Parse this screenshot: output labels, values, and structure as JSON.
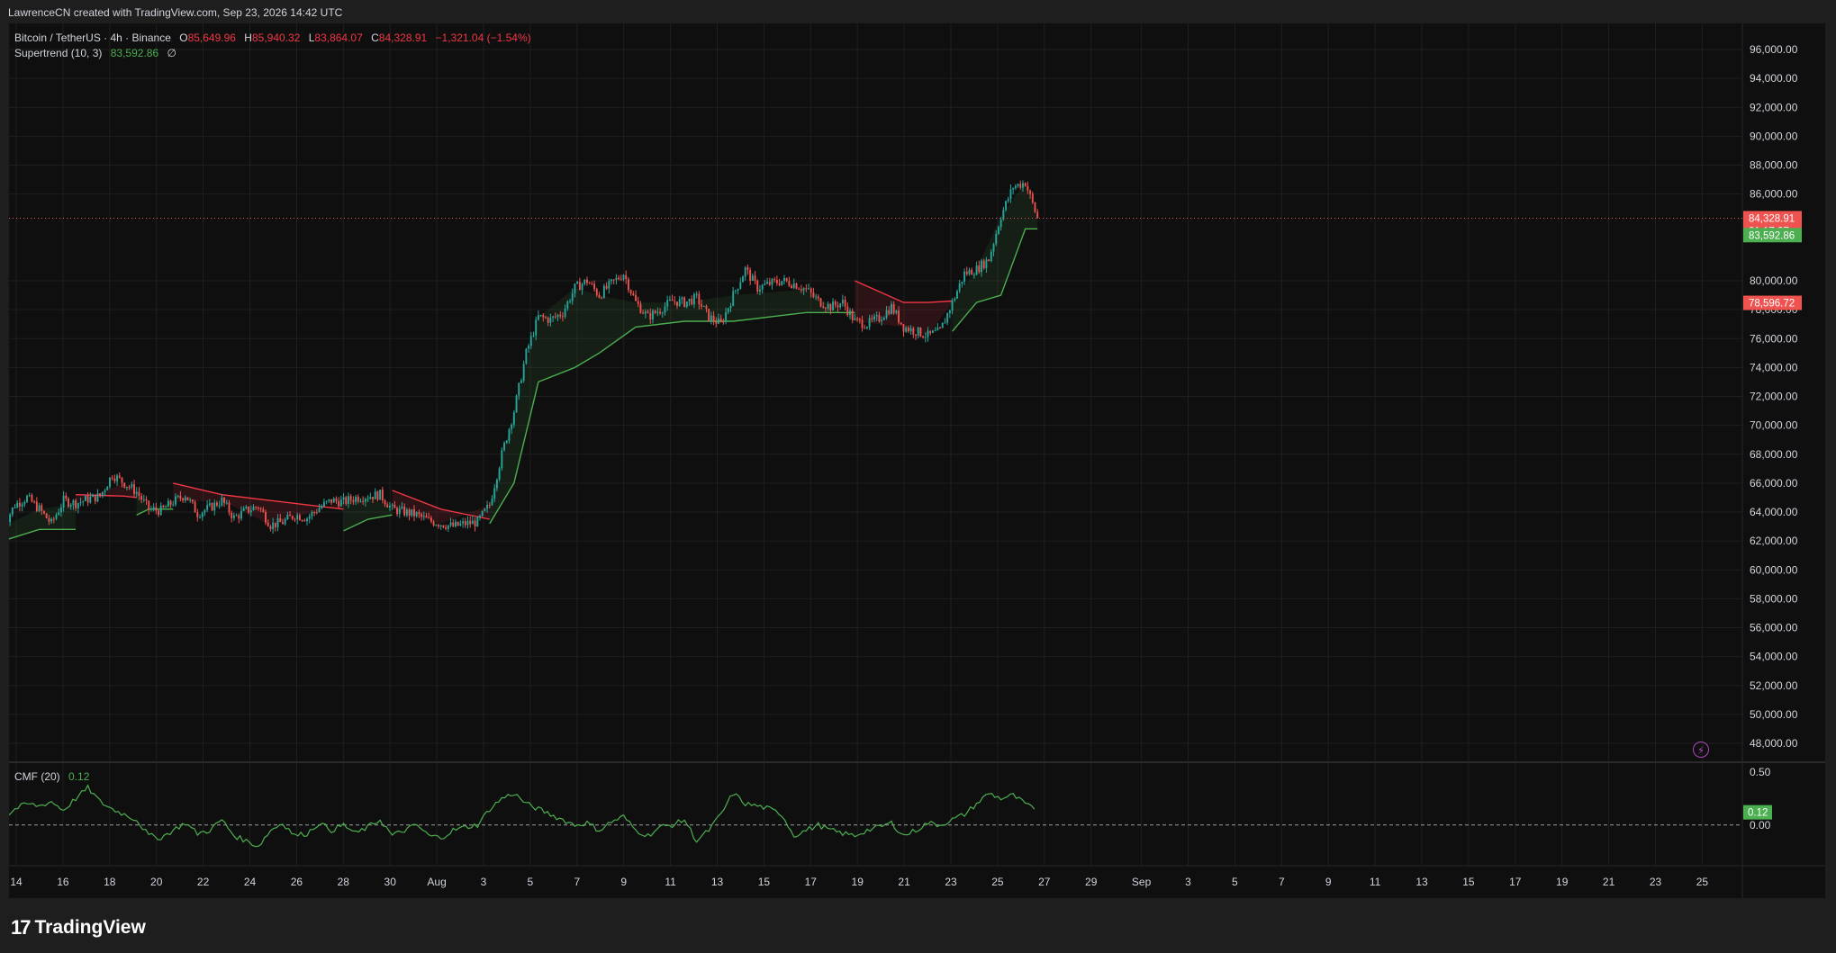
{
  "header": {
    "credit": "LawrenceCN created with TradingView.com, Sep 23, 2026 14:42 UTC"
  },
  "legend": {
    "symbol": "Bitcoin / TetherUS · 4h · Binance",
    "o_label": "O",
    "o_value": "85,649.96",
    "h_label": "H",
    "h_value": "85,940.32",
    "l_label": "L",
    "l_value": "83,864.07",
    "c_label": "C",
    "c_value": "84,328.91",
    "change": "−1,321.04 (−1.54%)",
    "supertrend_label": "Supertrend (10, 3)",
    "supertrend_value": "83,592.86",
    "supertrend_extra": "∅",
    "cmf_label": "CMF (20)",
    "cmf_value": "0.12"
  },
  "badges": {
    "price": "84,328.91",
    "countdown": "01:17:07",
    "supertrend": "83,592.86",
    "upper": "78,596.72",
    "cmf": "0.12"
  },
  "brand": {
    "logo": "17",
    "name": "TradingView"
  },
  "colors": {
    "up": "#26a69a",
    "down": "#ef5350",
    "st_up": "#4caf50",
    "st_down": "#f23645",
    "bg": "#0f0f0f",
    "grid": "#1f1f1f",
    "text": "#d1d4dc"
  },
  "chart_data": {
    "type": "candlestick",
    "timeframe": "4h",
    "y_ticks": [
      "96,000.00",
      "94,000.00",
      "92,000.00",
      "90,000.00",
      "88,000.00",
      "86,000.00",
      "80,000.00",
      "78,000.00",
      "76,000.00",
      "74,000.00",
      "72,000.00",
      "70,000.00",
      "68,000.00",
      "66,000.00",
      "64,000.00",
      "62,000.00",
      "60,000.00",
      "58,000.00",
      "56,000.00",
      "54,000.00",
      "52,000.00",
      "50,000.00",
      "48,000.00"
    ],
    "y_tick_values": [
      96000,
      94000,
      92000,
      90000,
      88000,
      86000,
      80000,
      78000,
      76000,
      74000,
      72000,
      70000,
      68000,
      66000,
      64000,
      62000,
      60000,
      58000,
      56000,
      54000,
      52000,
      50000,
      48000
    ],
    "ylim": [
      47500,
      97500
    ],
    "x_ticks": [
      "14",
      "16",
      "18",
      "20",
      "22",
      "24",
      "26",
      "28",
      "30",
      "Aug",
      "3",
      "5",
      "7",
      "9",
      "11",
      "13",
      "15",
      "17",
      "19",
      "21",
      "23",
      "25",
      "27",
      "29",
      "Sep",
      "3",
      "5",
      "7",
      "9",
      "11",
      "13",
      "15",
      "17",
      "19",
      "21",
      "23",
      "25"
    ],
    "close_path": [
      [
        0,
        63000
      ],
      [
        1,
        64500
      ],
      [
        2,
        65000
      ],
      [
        3,
        64200
      ],
      [
        4,
        63200
      ],
      [
        5,
        64800
      ],
      [
        6,
        64600
      ],
      [
        7,
        64900
      ],
      [
        8,
        65100
      ],
      [
        9,
        66600
      ],
      [
        10,
        66000
      ],
      [
        11,
        65400
      ],
      [
        12,
        64200
      ],
      [
        13,
        64100
      ],
      [
        14,
        64700
      ],
      [
        15,
        65200
      ],
      [
        16,
        63900
      ],
      [
        17,
        64300
      ],
      [
        18,
        64800
      ],
      [
        19,
        63600
      ],
      [
        20,
        64100
      ],
      [
        21,
        64400
      ],
      [
        22,
        63100
      ],
      [
        23,
        63300
      ],
      [
        24,
        63800
      ],
      [
        25,
        63600
      ],
      [
        26,
        64300
      ],
      [
        27,
        64800
      ],
      [
        28,
        64700
      ],
      [
        29,
        65000
      ],
      [
        30,
        65100
      ],
      [
        31,
        65200
      ],
      [
        32,
        64200
      ],
      [
        33,
        64000
      ],
      [
        34,
        63800
      ],
      [
        35,
        63400
      ],
      [
        36,
        63200
      ],
      [
        37,
        63000
      ],
      [
        38,
        63200
      ],
      [
        39,
        63300
      ],
      [
        40,
        64500
      ],
      [
        41,
        68000
      ],
      [
        42,
        71000
      ],
      [
        43,
        75000
      ],
      [
        44,
        77500
      ],
      [
        45,
        77300
      ],
      [
        46,
        77800
      ],
      [
        47,
        79500
      ],
      [
        48,
        80000
      ],
      [
        49,
        79000
      ],
      [
        50,
        79800
      ],
      [
        51,
        80500
      ],
      [
        52,
        78500
      ],
      [
        53,
        77500
      ],
      [
        54,
        78000
      ],
      [
        55,
        78600
      ],
      [
        56,
        78500
      ],
      [
        57,
        78800
      ],
      [
        58,
        77500
      ],
      [
        59,
        77000
      ],
      [
        60,
        79000
      ],
      [
        61,
        80800
      ],
      [
        62,
        79500
      ],
      [
        63,
        79800
      ],
      [
        64,
        80000
      ],
      [
        65,
        79800
      ],
      [
        66,
        79400
      ],
      [
        67,
        78600
      ],
      [
        68,
        78200
      ],
      [
        69,
        78500
      ],
      [
        70,
        77200
      ],
      [
        71,
        77000
      ],
      [
        72,
        77400
      ],
      [
        73,
        78200
      ],
      [
        74,
        76800
      ],
      [
        75,
        76500
      ],
      [
        76,
        76200
      ],
      [
        77,
        76500
      ],
      [
        78,
        78500
      ],
      [
        79,
        80500
      ],
      [
        80,
        80800
      ],
      [
        81,
        81500
      ],
      [
        82,
        84500
      ],
      [
        83,
        86500
      ],
      [
        84,
        86800
      ],
      [
        85,
        84328.91
      ]
    ],
    "x_range_days": [
      13.0,
      26.0
    ],
    "days_per_step": 0.5,
    "supertrend_segments": [
      {
        "trend": "up",
        "points": [
          [
            0,
            62000
          ],
          [
            3,
            62800
          ],
          [
            6,
            62800
          ]
        ]
      },
      {
        "trend": "down",
        "points": [
          [
            6,
            65200
          ],
          [
            10,
            65100
          ],
          [
            11,
            65000
          ]
        ]
      },
      {
        "trend": "up",
        "points": [
          [
            11,
            63800
          ],
          [
            12,
            64200
          ],
          [
            14,
            64200
          ]
        ]
      },
      {
        "trend": "down",
        "points": [
          [
            14,
            66000
          ],
          [
            18,
            65200
          ],
          [
            22,
            64800
          ],
          [
            28,
            64200
          ]
        ]
      },
      {
        "trend": "up",
        "points": [
          [
            28,
            62700
          ],
          [
            30,
            63500
          ],
          [
            32,
            63800
          ]
        ]
      },
      {
        "trend": "down",
        "points": [
          [
            32,
            65500
          ],
          [
            36,
            64200
          ],
          [
            40,
            63500
          ]
        ]
      },
      {
        "trend": "up",
        "points": [
          [
            40,
            63200
          ],
          [
            42,
            66000
          ],
          [
            44,
            73000
          ],
          [
            47,
            74000
          ],
          [
            49,
            75000
          ],
          [
            52,
            76800
          ],
          [
            56,
            77200
          ],
          [
            60,
            77200
          ],
          [
            66,
            77800
          ],
          [
            70,
            77800
          ]
        ]
      },
      {
        "trend": "down",
        "points": [
          [
            70,
            80000
          ],
          [
            74,
            78500
          ],
          [
            76,
            78500
          ],
          [
            78,
            78596.72
          ]
        ]
      },
      {
        "trend": "up",
        "points": [
          [
            78,
            76500
          ],
          [
            80,
            78500
          ],
          [
            82,
            79000
          ],
          [
            84,
            83592.86
          ],
          [
            85,
            83592.86
          ]
        ]
      }
    ],
    "cmf": {
      "y_ticks": [
        "0.50",
        "0.00"
      ],
      "y_tick_values": [
        0.5,
        0.0
      ],
      "ylim": [
        -0.35,
        0.55
      ],
      "values": [
        0.05,
        0.15,
        0.2,
        0.18,
        0.22,
        0.14,
        0.25,
        0.35,
        0.22,
        0.15,
        0.1,
        0.05,
        -0.1,
        -0.12,
        -0.05,
        0.02,
        -0.08,
        -0.05,
        0.05,
        -0.1,
        -0.15,
        -0.2,
        -0.05,
        0.02,
        -0.1,
        -0.08,
        0.02,
        -0.05,
        0.0,
        -0.08,
        -0.02,
        0.05,
        -0.1,
        -0.05,
        0.0,
        -0.1,
        -0.12,
        -0.05,
        -0.02,
        0.0,
        0.15,
        0.25,
        0.3,
        0.2,
        0.15,
        0.1,
        0.05,
        0.0,
        0.02,
        -0.05,
        0.03,
        0.08,
        -0.05,
        -0.1,
        -0.02,
        0.0,
        0.05,
        -0.15,
        -0.05,
        0.1,
        0.3,
        0.2,
        0.18,
        0.15,
        0.1,
        -0.1,
        -0.05,
        0.0,
        -0.05,
        -0.08,
        -0.1,
        -0.05,
        -0.02,
        0.02,
        -0.1,
        -0.05,
        0.02,
        0.0,
        0.05,
        0.1,
        0.2,
        0.3,
        0.25,
        0.28,
        0.2,
        0.12
      ]
    }
  }
}
